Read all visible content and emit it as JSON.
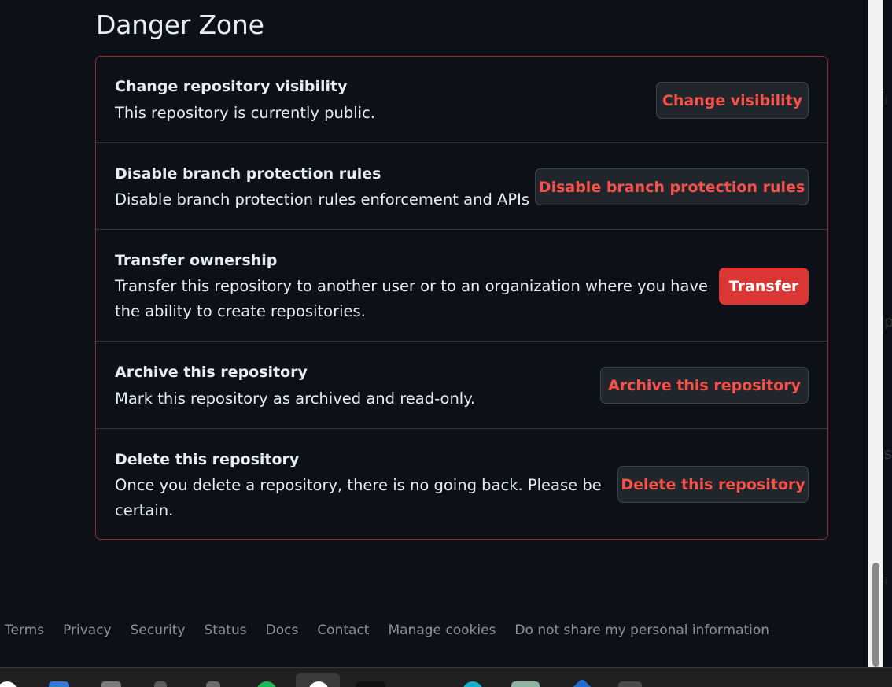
{
  "danger_zone": {
    "title": "Danger Zone",
    "rows": [
      {
        "title": "Change repository visibility",
        "description": "This repository is currently public.",
        "button": "Change visibility"
      },
      {
        "title": "Disable branch protection rules",
        "description": "Disable branch protection rules enforcement and APIs",
        "button": "Disable branch protection rules"
      },
      {
        "title": "Transfer ownership",
        "description": "Transfer this repository to another user or to an organization where you have the ability to create repositories.",
        "button": "Transfer"
      },
      {
        "title": "Archive this repository",
        "description": "Mark this repository as archived and read-only.",
        "button": "Archive this repository"
      },
      {
        "title": "Delete this repository",
        "description": "Once you delete a repository, there is no going back. Please be certain.",
        "button": "Delete this repository"
      }
    ]
  },
  "footer": {
    "links": [
      "Terms",
      "Privacy",
      "Security",
      "Status",
      "Docs",
      "Contact",
      "Manage cookies",
      "Do not share my personal information"
    ]
  },
  "side_panel": {
    "clipped_chars": [
      "i",
      "p",
      "s",
      "i"
    ]
  },
  "colors": {
    "background": "#0d1117",
    "danger_border": "#8e2e33",
    "danger_text": "#f85149",
    "danger_solid": "#da3633",
    "button_bg": "#21262d",
    "muted_text": "#8b949e"
  }
}
